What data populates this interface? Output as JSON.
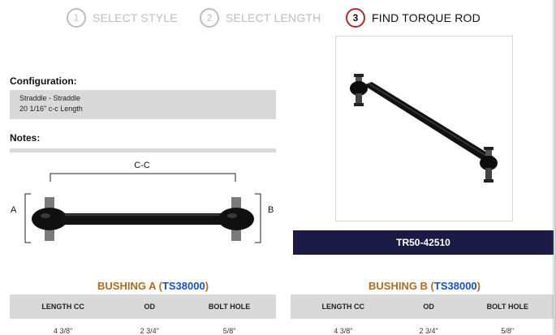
{
  "steps": [
    {
      "num": "1",
      "label": "SELECT STYLE",
      "active": false
    },
    {
      "num": "2",
      "label": "SELECT LENGTH",
      "active": false
    },
    {
      "num": "3",
      "label": "FIND TORQUE ROD",
      "active": true
    }
  ],
  "configuration": {
    "title": "Configuration:",
    "line1": "Straddle - Straddle",
    "line2": "20 1/16\" c-c Length"
  },
  "notes": {
    "title": "Notes:"
  },
  "diagram": {
    "cc_label": "C-C",
    "a_label": "A",
    "b_label": "B"
  },
  "product": {
    "part_number": "TR50-42510"
  },
  "bushing_a": {
    "title_prefix": "BUSHING A (",
    "link": "TS38000",
    "title_suffix": ")",
    "headers": [
      "LENGTH CC",
      "OD",
      "BOLT HOLE"
    ],
    "values": [
      "4 3/8\"",
      "2 3/4\"",
      "5/8\""
    ]
  },
  "bushing_b": {
    "title_prefix": "BUSHING B (",
    "link": "TS38000",
    "title_suffix": ")",
    "headers": [
      "LENGTH CC",
      "OD",
      "BOLT HOLE"
    ],
    "values": [
      "4 3/8\"",
      "2 3/4\"",
      "5/8\""
    ]
  },
  "colors": {
    "accent_red": "#b0282e",
    "navy_bar": "#1a1a45",
    "bushing_orange": "#b36b1e",
    "link_blue": "#1a4fd0",
    "gray_panel": "#d9d9d9"
  }
}
